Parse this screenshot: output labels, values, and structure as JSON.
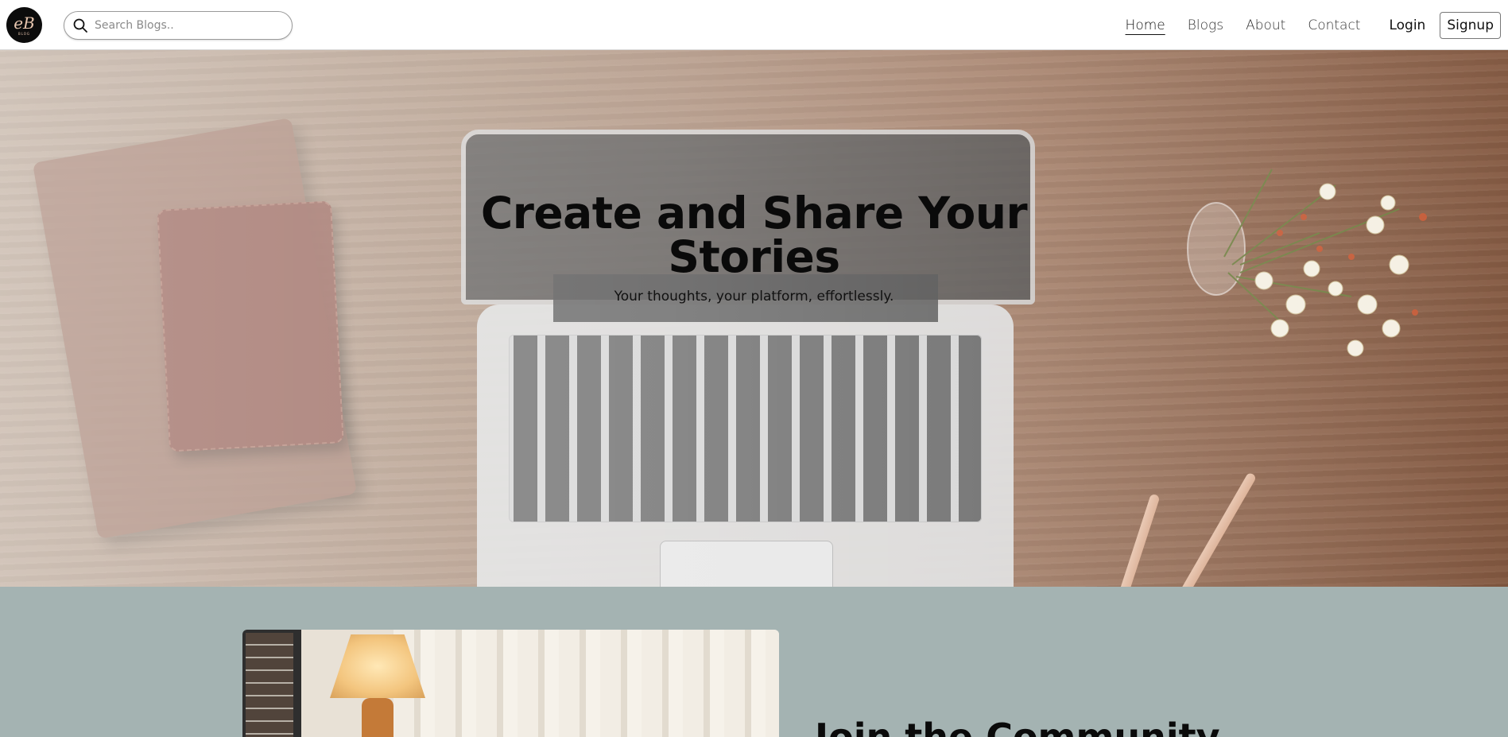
{
  "nav": {
    "logo_monogram": "eB",
    "logo_text": "BLOG",
    "search_placeholder": "Search Blogs..",
    "links": [
      "Home",
      "Blogs",
      "About",
      "Contact"
    ],
    "active_link": "Home",
    "login_label": "Login",
    "signup_label": "Signup"
  },
  "hero": {
    "title": "Create and Share Your Stories",
    "subtitle": "Your thoughts, your platform, effortlessly."
  },
  "community": {
    "title": "Join the Community"
  },
  "colors": {
    "nav_bg": "#ffffff",
    "section_bg": "#a4b3b2",
    "text": "#0a0a0a"
  },
  "icons": {
    "search": "search-icon"
  }
}
